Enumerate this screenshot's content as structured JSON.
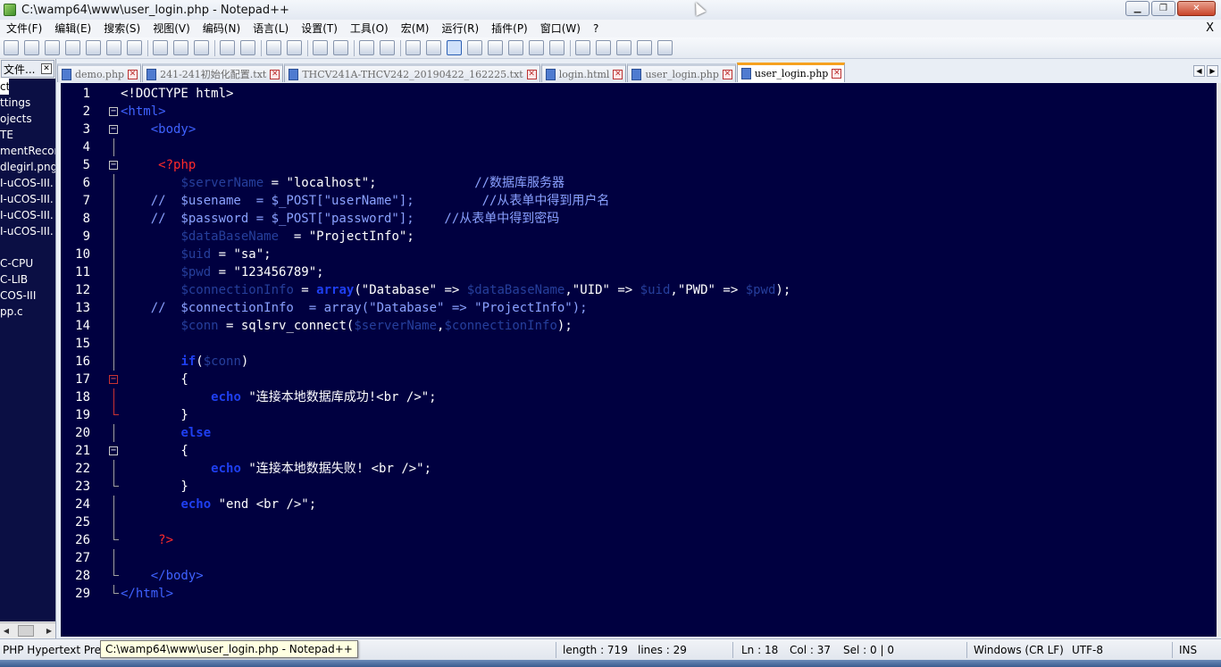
{
  "window": {
    "title": "C:\\wamp64\\www\\user_login.php - Notepad++",
    "minimize": "▁",
    "maximize": "❐",
    "close": "✕"
  },
  "menu": {
    "items": [
      "文件(F)",
      "编辑(E)",
      "搜索(S)",
      "视图(V)",
      "编码(N)",
      "语言(L)",
      "设置(T)",
      "工具(O)",
      "宏(M)",
      "运行(R)",
      "插件(P)",
      "窗口(W)",
      "?"
    ],
    "close": "X"
  },
  "left_panel": {
    "title": "文件...",
    "close": "✕",
    "items": [
      "ct",
      "ttings",
      "ojects",
      "TE",
      "mentRecord",
      "dlegirl.png",
      "I-uCOS-III.",
      "I-uCOS-III.",
      "I-uCOS-III.",
      "I-uCOS-III.",
      "",
      "C-CPU",
      "C-LIB",
      "COS-III",
      "pp.c"
    ]
  },
  "tabs": [
    {
      "label": "demo.php",
      "active": false
    },
    {
      "label": "241-241初始化配置.txt",
      "active": false
    },
    {
      "label": "THCV241A-THCV242_20190422_162225.txt",
      "active": false
    },
    {
      "label": "login.html",
      "active": false
    },
    {
      "label": "user_login.php",
      "active": false
    },
    {
      "label": "user_login.php",
      "active": true
    }
  ],
  "tab_close": "✕",
  "editor": {
    "lines": [
      {
        "n": "1",
        "fold": "",
        "tokens": [
          [
            "plain",
            "<!DOCTYPE html>"
          ]
        ]
      },
      {
        "n": "2",
        "fold": "box",
        "tokens": [
          [
            "kw-tag",
            "<html>"
          ]
        ]
      },
      {
        "n": "3",
        "fold": "box",
        "tokens": [
          [
            "plain",
            "    "
          ],
          [
            "kw-tag",
            "<body>"
          ]
        ]
      },
      {
        "n": "4",
        "fold": "line",
        "tokens": []
      },
      {
        "n": "5",
        "fold": "box",
        "tokens": [
          [
            "plain",
            "     "
          ],
          [
            "php-open",
            "<?php"
          ]
        ]
      },
      {
        "n": "6",
        "fold": "line",
        "tokens": [
          [
            "plain",
            "        "
          ],
          [
            "var",
            "$serverName"
          ],
          [
            "plain",
            " = "
          ],
          [
            "str",
            "\"localhost\""
          ],
          [
            "plain",
            ";             "
          ],
          [
            "cmt",
            "//数据库服务器"
          ]
        ]
      },
      {
        "n": "7",
        "fold": "line",
        "tokens": [
          [
            "cmt",
            "    //  $usename  = $_POST[\"userName\"];         //从表单中得到用户名"
          ]
        ]
      },
      {
        "n": "8",
        "fold": "line",
        "tokens": [
          [
            "cmt",
            "    //  $password = $_POST[\"password\"];    //从表单中得到密码"
          ]
        ]
      },
      {
        "n": "9",
        "fold": "line",
        "tokens": [
          [
            "plain",
            "        "
          ],
          [
            "var",
            "$dataBaseName"
          ],
          [
            "plain",
            "  = "
          ],
          [
            "str",
            "\"ProjectInfo\""
          ],
          [
            "plain",
            ";"
          ]
        ]
      },
      {
        "n": "10",
        "fold": "line",
        "tokens": [
          [
            "plain",
            "        "
          ],
          [
            "var",
            "$uid"
          ],
          [
            "plain",
            " = "
          ],
          [
            "str",
            "\"sa\""
          ],
          [
            "plain",
            ";"
          ]
        ]
      },
      {
        "n": "11",
        "fold": "line",
        "tokens": [
          [
            "plain",
            "        "
          ],
          [
            "var",
            "$pwd"
          ],
          [
            "plain",
            " = "
          ],
          [
            "str",
            "\"123456789\""
          ],
          [
            "plain",
            ";"
          ]
        ]
      },
      {
        "n": "12",
        "fold": "line",
        "tokens": [
          [
            "plain",
            "        "
          ],
          [
            "var",
            "$connectionInfo"
          ],
          [
            "plain",
            " = "
          ],
          [
            "kw",
            "array"
          ],
          [
            "plain",
            "("
          ],
          [
            "str",
            "\"Database\""
          ],
          [
            "plain",
            " => "
          ],
          [
            "var",
            "$dataBaseName"
          ],
          [
            "plain",
            ","
          ],
          [
            "str",
            "\"UID\""
          ],
          [
            "plain",
            " => "
          ],
          [
            "var",
            "$uid"
          ],
          [
            "plain",
            ","
          ],
          [
            "str",
            "\"PWD\""
          ],
          [
            "plain",
            " => "
          ],
          [
            "var",
            "$pwd"
          ],
          [
            "plain",
            ");"
          ]
        ]
      },
      {
        "n": "13",
        "fold": "line",
        "tokens": [
          [
            "cmt",
            "    //  $connectionInfo  = array(\"Database\" => \"ProjectInfo\");"
          ]
        ]
      },
      {
        "n": "14",
        "fold": "line",
        "tokens": [
          [
            "plain",
            "        "
          ],
          [
            "var",
            "$conn"
          ],
          [
            "plain",
            " = sqlsrv_connect("
          ],
          [
            "var",
            "$serverName"
          ],
          [
            "plain",
            ","
          ],
          [
            "var",
            "$connectionInfo"
          ],
          [
            "plain",
            ");"
          ]
        ]
      },
      {
        "n": "15",
        "fold": "line",
        "tokens": []
      },
      {
        "n": "16",
        "fold": "line",
        "tokens": [
          [
            "plain",
            "        "
          ],
          [
            "kw",
            "if"
          ],
          [
            "plain",
            "("
          ],
          [
            "var",
            "$conn"
          ],
          [
            "plain",
            ")"
          ]
        ]
      },
      {
        "n": "17",
        "fold": "redbox",
        "tokens": [
          [
            "plain",
            "        {"
          ]
        ]
      },
      {
        "n": "18",
        "fold": "redline",
        "tokens": [
          [
            "plain",
            "            "
          ],
          [
            "kw",
            "echo"
          ],
          [
            "plain",
            " "
          ],
          [
            "str",
            "\"连接本地数据库成功!<br />\""
          ],
          [
            "plain",
            ";"
          ]
        ]
      },
      {
        "n": "19",
        "fold": "redend",
        "tokens": [
          [
            "plain",
            "        }"
          ]
        ]
      },
      {
        "n": "20",
        "fold": "line",
        "tokens": [
          [
            "plain",
            "        "
          ],
          [
            "kw",
            "else"
          ]
        ]
      },
      {
        "n": "21",
        "fold": "box",
        "tokens": [
          [
            "plain",
            "        {"
          ]
        ]
      },
      {
        "n": "22",
        "fold": "line",
        "tokens": [
          [
            "plain",
            "            "
          ],
          [
            "kw",
            "echo"
          ],
          [
            "plain",
            " "
          ],
          [
            "str",
            "\"连接本地数据失败! <br />\""
          ],
          [
            "plain",
            ";"
          ]
        ]
      },
      {
        "n": "23",
        "fold": "end",
        "tokens": [
          [
            "plain",
            "        }"
          ]
        ]
      },
      {
        "n": "24",
        "fold": "line",
        "tokens": [
          [
            "plain",
            "        "
          ],
          [
            "kw",
            "echo"
          ],
          [
            "plain",
            " "
          ],
          [
            "str",
            "\"end <br />\""
          ],
          [
            "plain",
            ";"
          ]
        ]
      },
      {
        "n": "25",
        "fold": "line",
        "tokens": []
      },
      {
        "n": "26",
        "fold": "end",
        "tokens": [
          [
            "plain",
            "     "
          ],
          [
            "php-open",
            "?>"
          ]
        ]
      },
      {
        "n": "27",
        "fold": "line",
        "tokens": []
      },
      {
        "n": "28",
        "fold": "end",
        "tokens": [
          [
            "plain",
            "    "
          ],
          [
            "kw-tag",
            "</body>"
          ]
        ]
      },
      {
        "n": "29",
        "fold": "end",
        "tokens": [
          [
            "kw-tag",
            "</html>"
          ]
        ]
      }
    ]
  },
  "status": {
    "language": "PHP Hypertext Prep",
    "length": "length : 719",
    "lines": "lines : 29",
    "ln": "Ln : 18",
    "col": "Col : 37",
    "sel": "Sel : 0 | 0",
    "eol": "Windows (CR LF)",
    "encoding": "UTF-8",
    "mode": "INS"
  },
  "tooltip": "C:\\wamp64\\www\\user_login.php - Notepad++",
  "colors": {
    "editor_bg": "#000040",
    "tag": "#3f62ff",
    "php_delim": "#ff2a2a",
    "comment": "#8ba2ff",
    "variable": "#263f9c",
    "active_tab_accent": "#f6a11f"
  }
}
